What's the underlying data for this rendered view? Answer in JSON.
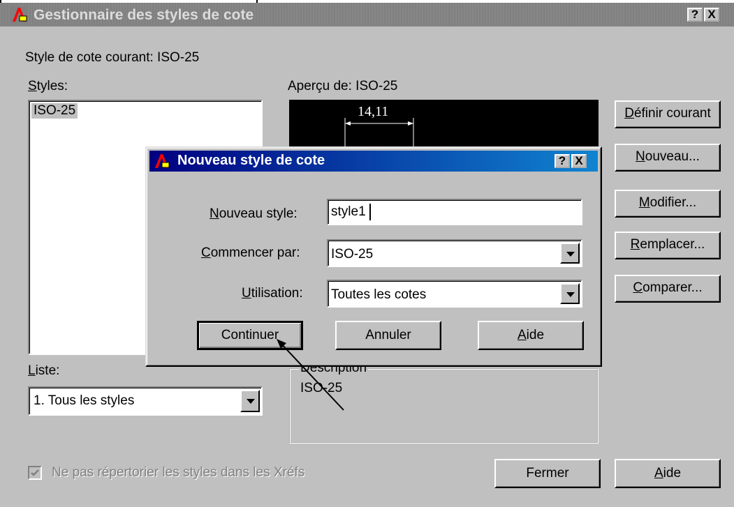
{
  "main_window": {
    "title": "Gestionnaire des styles de cote",
    "help_button": "?",
    "close_button": "X",
    "current_style_label": "Style de cote courant: ISO-25",
    "styles_label": "Styles:",
    "styles_list": [
      "ISO-25"
    ],
    "preview_label": "Aperçu de: ISO-25",
    "preview_dimension": "14,11",
    "buttons": {
      "set_current": "Définir courant",
      "new": "Nouveau...",
      "modify": "Modifier...",
      "override": "Remplacer...",
      "compare": "Comparer...",
      "close": "Fermer",
      "help": "Aide"
    },
    "list_label": "Liste:",
    "list_selected": "1. Tous les styles",
    "description_title": "Description",
    "description_text": "ISO-25",
    "xref_checkbox_label": "Ne pas répertorier les styles dans les Xréfs",
    "xref_checkbox_checked": true
  },
  "new_style_dialog": {
    "title": "Nouveau style de cote",
    "help_button": "?",
    "close_button": "X",
    "new_style_label": "Nouveau style:",
    "new_style_value": "style1",
    "start_with_label": "Commencer par:",
    "start_with_value": "ISO-25",
    "use_for_label": "Utilisation:",
    "use_for_value": "Toutes les cotes",
    "buttons": {
      "continue": "Continuer",
      "cancel": "Annuler",
      "help": "Aide"
    }
  },
  "colors": {
    "title_active_start": "#000080",
    "title_active_end": "#1084d0",
    "title_inactive": "#808080",
    "face": "#c0c0c0"
  }
}
